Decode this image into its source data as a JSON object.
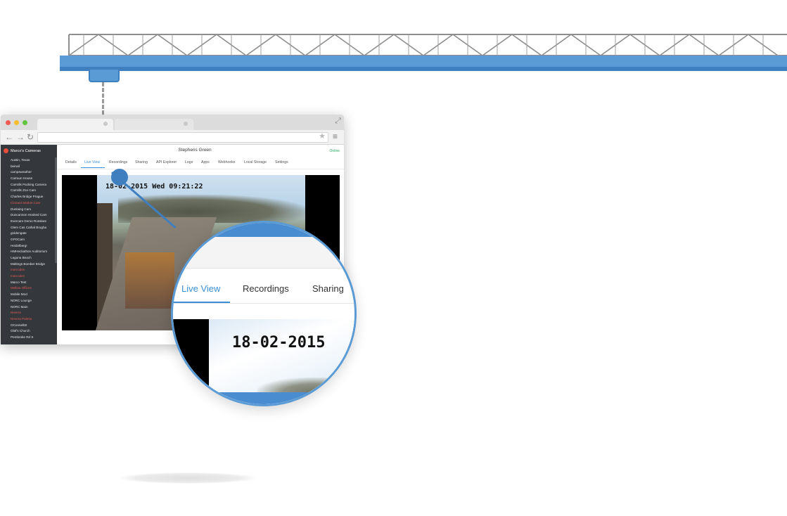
{
  "sidebar": {
    "title": "Marco's Cameras",
    "items": [
      {
        "label": "Austin, Texas",
        "warning": false
      },
      {
        "label": "beirwil",
        "warning": false
      },
      {
        "label": "campsweather",
        "warning": false
      },
      {
        "label": "Carraun House",
        "warning": false
      },
      {
        "label": "Carrolls Packing Camera",
        "warning": false
      },
      {
        "label": "Carrolls Zoo Cam",
        "warning": false
      },
      {
        "label": "Charles Bridge Prague",
        "warning": false
      },
      {
        "label": "Clonard Market Cam",
        "warning": true
      },
      {
        "label": "Dunlaing Cam",
        "warning": false
      },
      {
        "label": "Duncannon Hooked Cam",
        "warning": false
      },
      {
        "label": "Evercam Demo Rosslare",
        "warning": false
      },
      {
        "label": "Glem Cas Cathal Brugha",
        "warning": false
      },
      {
        "label": "goldengate",
        "warning": false
      },
      {
        "label": "GPOCam",
        "warning": false
      },
      {
        "label": "Heidelberg!",
        "warning": false
      },
      {
        "label": "HMHeckathon Auditorium",
        "warning": false
      },
      {
        "label": "Laguna Beach",
        "warning": false
      },
      {
        "label": "Maltings Bomber Bridge",
        "warning": false
      },
      {
        "label": "marcodev",
        "warning": true
      },
      {
        "label": "marcodev",
        "warning": true
      },
      {
        "label": "Marco Test",
        "warning": false
      },
      {
        "label": "Mellow Offices",
        "warning": true
      },
      {
        "label": "Mobile Mod",
        "warning": false
      },
      {
        "label": "NDRC Lounge",
        "warning": false
      },
      {
        "label": "NDRC Main",
        "warning": false
      },
      {
        "label": "Nevera",
        "warning": true
      },
      {
        "label": "Nevera Palmia",
        "warning": true
      },
      {
        "label": "OConnellSt",
        "warning": false
      },
      {
        "label": "Olaf's Church",
        "warning": false
      },
      {
        "label": "Pembroke Rd S",
        "warning": false
      }
    ]
  },
  "camera": {
    "name": "Stephens Green",
    "status": "Online",
    "timestamp": "18-02-2015 Wed 09:21:22"
  },
  "tabs": [
    "Details",
    "Live View",
    "Recordings",
    "Sharing",
    "API Explorer",
    "Logs",
    "Apps",
    "Webhooks",
    "Local Storage",
    "Settings"
  ],
  "active_tab": "Live View",
  "magnifier": {
    "tabs": [
      "Live View",
      "Recordings",
      "Sharing"
    ],
    "timestamp": "18-02-2015"
  },
  "icons": {
    "back": "back-arrow-icon",
    "forward": "forward-arrow-icon",
    "reload": "reload-icon",
    "bookmark": "star-icon",
    "menu": "hamburger-menu-icon",
    "expand": "expand-icon"
  },
  "colors": {
    "accent": "#3a8fd6",
    "beam": "#5b9bd5",
    "online": "#27ae60",
    "warning": "#e05a4f",
    "sidebar_bg": "#34383d"
  }
}
